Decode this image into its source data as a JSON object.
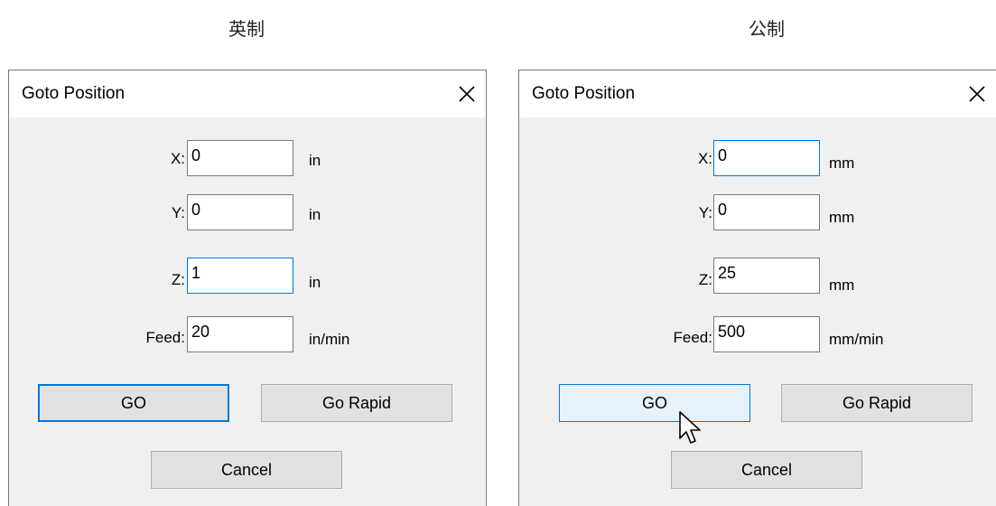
{
  "captions": {
    "left": "英制",
    "right": "公制"
  },
  "dialogs": {
    "imperial": {
      "title": "Goto Position",
      "x": {
        "label": "X:",
        "value": "0",
        "unit": "in"
      },
      "y": {
        "label": "Y:",
        "value": "0",
        "unit": "in"
      },
      "z": {
        "label": "Z:",
        "value": "1",
        "unit": "in"
      },
      "feed": {
        "label": "Feed:",
        "value": "20",
        "unit": "in/min"
      },
      "go_label": "GO",
      "go_rapid_label": "Go Rapid",
      "cancel_label": "Cancel"
    },
    "metric": {
      "title": "Goto Position",
      "x": {
        "label": "X:",
        "value": "0",
        "unit": "mm"
      },
      "y": {
        "label": "Y:",
        "value": "0",
        "unit": "mm"
      },
      "z": {
        "label": "Z:",
        "value": "25",
        "unit": "mm"
      },
      "feed": {
        "label": "Feed:",
        "value": "500",
        "unit": "mm/min"
      },
      "go_label": "GO",
      "go_rapid_label": "Go Rapid",
      "cancel_label": "Cancel"
    }
  },
  "colors": {
    "dialog_bg": "#f0f0f0",
    "focus_accent": "#0078d7",
    "button_bg": "#e1e1e1",
    "button_hover_bg": "#e5f1fb"
  },
  "icons": {
    "close": "close-icon",
    "cursor": "mouse-pointer-icon"
  }
}
